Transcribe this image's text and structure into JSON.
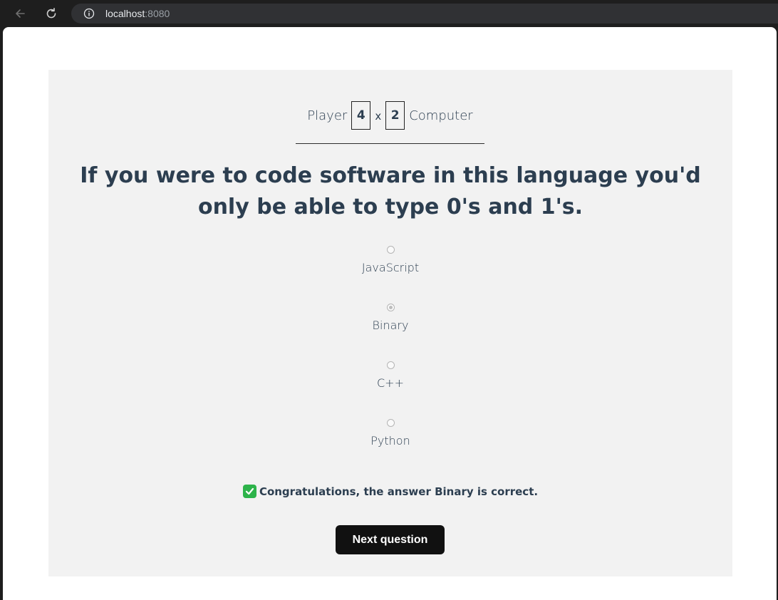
{
  "browser": {
    "url_host": "localhost",
    "url_port": ":8080",
    "icons": {
      "back": "back-arrow-icon",
      "reload": "reload-icon",
      "info": "info-icon"
    }
  },
  "scoreboard": {
    "player_label": "Player",
    "player_score": "4",
    "separator": "x",
    "computer_score": "2",
    "computer_label": "Computer"
  },
  "question": "If you were to code software in this language you'd only be able to type 0's and 1's.",
  "options": [
    {
      "label": "JavaScript",
      "selected": false
    },
    {
      "label": "Binary",
      "selected": true
    },
    {
      "label": "C++",
      "selected": false
    },
    {
      "label": "Python",
      "selected": false
    }
  ],
  "feedback": {
    "icon": "check-mark-icon",
    "text": "Congratulations, the answer Binary is correct."
  },
  "next_button": {
    "label": "Next question"
  },
  "colors": {
    "card_bg": "#f2f2f2",
    "text": "#2c3e50",
    "button_bg": "#111111",
    "check_green": "#2db34a"
  }
}
